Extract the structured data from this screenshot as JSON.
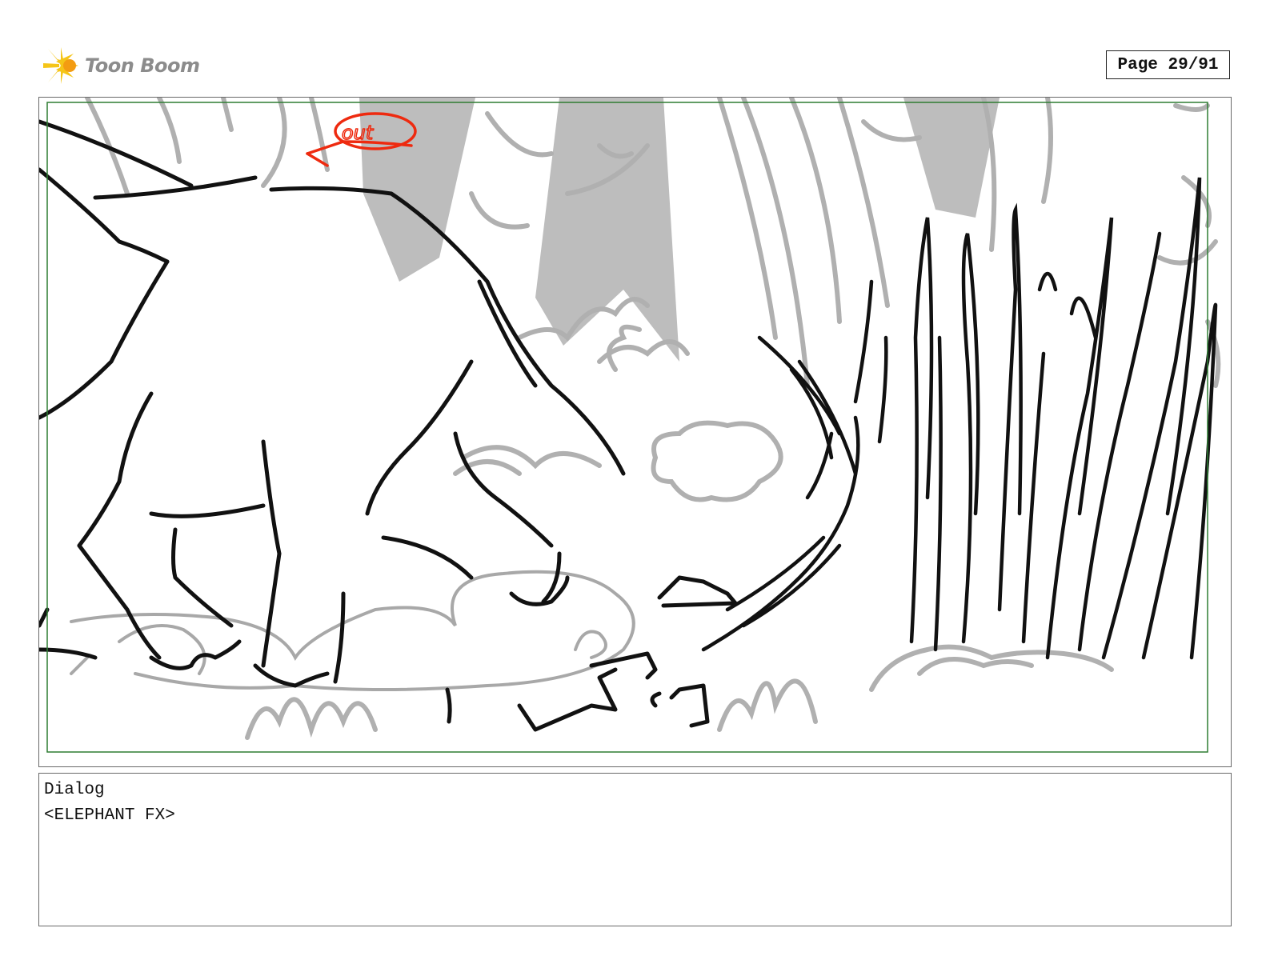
{
  "header": {
    "logo_text": "Toon Boom",
    "page_label": "Page 29/91"
  },
  "panel": {
    "image": "storyboard-sketch-elephant-in-forest",
    "annotation_text": "out"
  },
  "dialog": {
    "heading": "Dialog",
    "text": "<ELEPHANT FX>"
  },
  "colors": {
    "frame_border": "#6a6a6a",
    "safe_area": "#2e7d32",
    "sketch_black": "#111111",
    "sketch_gray": "#b0b0b0",
    "annotation_red": "#ee2a0f",
    "logo_yellow": "#f5c518"
  }
}
